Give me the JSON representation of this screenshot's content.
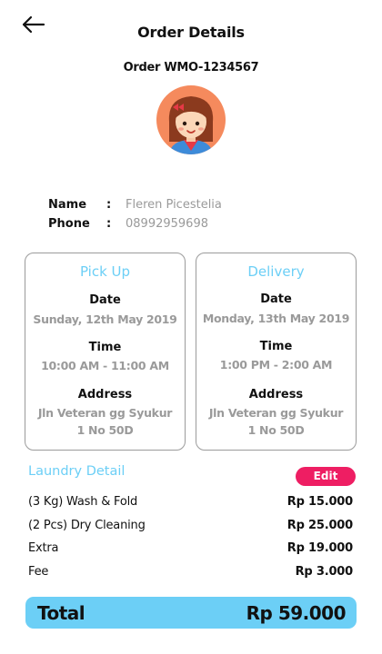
{
  "header": {
    "title": "Order Details",
    "back_icon": "arrow-left-icon"
  },
  "order": {
    "label": "Order WMO-1234567"
  },
  "customer": {
    "name_label": "Name",
    "name_value": "Fleren Picestelia",
    "phone_label": "Phone",
    "phone_value": "08992959698",
    "colon": ":"
  },
  "pickup": {
    "title": "Pick Up",
    "date_label": "Date",
    "date_value": "Sunday, 12th May 2019",
    "time_label": "Time",
    "time_value": "10:00 AM - 11:00 AM",
    "address_label": "Address",
    "address_line1": "Jln Veteran gg Syukur",
    "address_line2": "1 No 50D"
  },
  "delivery": {
    "title": "Delivery",
    "date_label": "Date",
    "date_value": "Monday, 13th May 2019",
    "time_label": "Time",
    "time_value": "1:00 PM - 2:00 AM",
    "address_label": "Address",
    "address_line1": "Jln Veteran gg Syukur",
    "address_line2": "1 No 50D"
  },
  "laundry": {
    "title": "Laundry Detail",
    "edit_label": "Edit",
    "items": [
      {
        "name": "(3 Kg) Wash & Fold",
        "price": "Rp 15.000"
      },
      {
        "name": "(2 Pcs) Dry Cleaning",
        "price": "Rp 25.000"
      },
      {
        "name": "Extra",
        "price": "Rp 19.000"
      },
      {
        "name": "Fee",
        "price": "Rp 3.000"
      }
    ]
  },
  "total": {
    "label": "Total",
    "value": "Rp 59.000"
  },
  "colors": {
    "accent": "#6ccff6",
    "edit": "#ee1e63",
    "muted": "#9a9a9a"
  }
}
